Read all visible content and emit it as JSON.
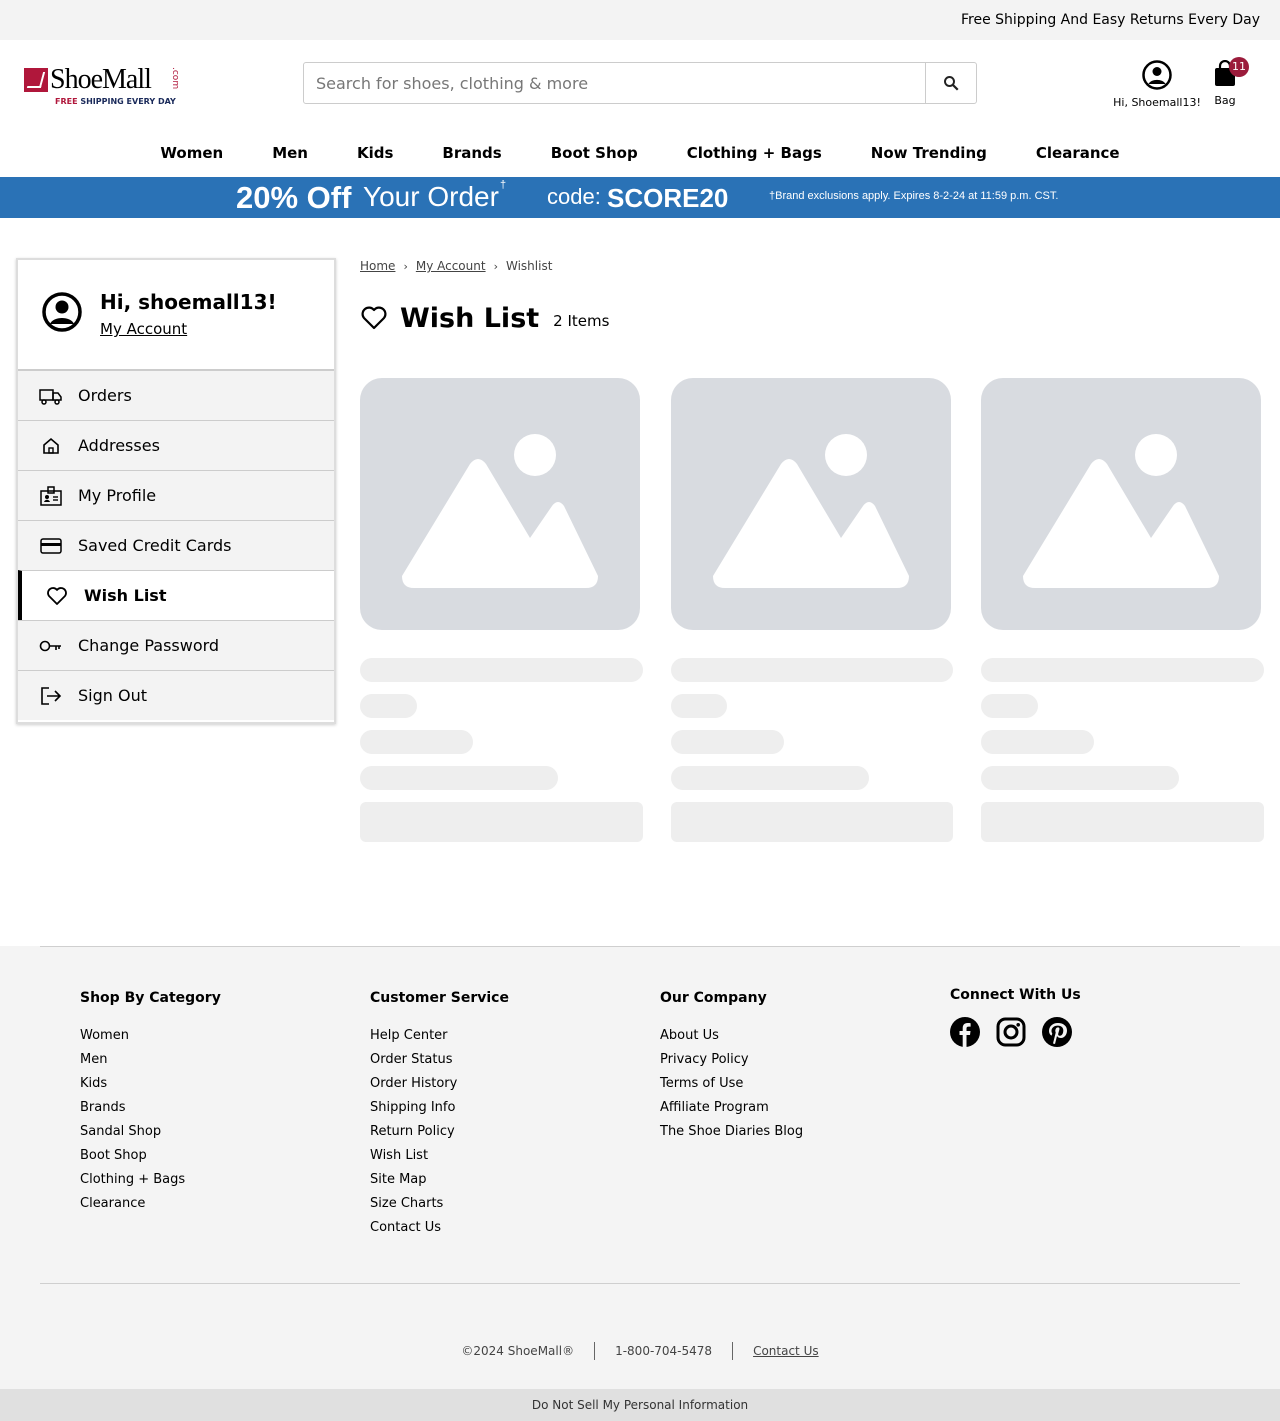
{
  "topbar": {
    "message": "Free Shipping And Easy Returns Every Day"
  },
  "header": {
    "logo_text": "ShoeMall",
    "logo_dotcom": ".com",
    "logo_tag_free": "FREE",
    "logo_tag_rest": " SHIPPING EVERY DAY",
    "search_placeholder": "Search for shoes, clothing & more",
    "account_label": "Hi, Shoemall13!",
    "bag_label": "Bag",
    "bag_count": "11"
  },
  "nav": {
    "items": [
      "Women",
      "Men",
      "Kids",
      "Brands",
      "Boot Shop",
      "Clothing + Bags",
      "Now Trending",
      "Clearance"
    ]
  },
  "promo": {
    "off": "20% Off",
    "your_order": "Your Order",
    "dagger": "†",
    "code_label": "code:",
    "code": "SCORE20",
    "fine_print": "†Brand exclusions apply. Expires 8-2-24 at 11:59 p.m. CST."
  },
  "sidebar": {
    "greeting": "Hi, shoemall13!",
    "my_account": "My Account",
    "items": [
      {
        "label": "Orders",
        "icon": "truck-icon"
      },
      {
        "label": "Addresses",
        "icon": "home-icon"
      },
      {
        "label": "My Profile",
        "icon": "id-badge-icon"
      },
      {
        "label": "Saved Credit Cards",
        "icon": "credit-card-icon"
      },
      {
        "label": "Wish List",
        "icon": "heart-icon",
        "active": true
      },
      {
        "label": "Change Password",
        "icon": "key-icon"
      },
      {
        "label": "Sign Out",
        "icon": "sign-out-icon"
      }
    ]
  },
  "breadcrumb": {
    "home": "Home",
    "account": "My Account",
    "current": "Wishlist"
  },
  "wishlist": {
    "title": "Wish List",
    "count": "2 Items"
  },
  "footer": {
    "col1": {
      "title": "Shop By Category",
      "links": [
        "Women",
        "Men",
        "Kids",
        "Brands",
        "Sandal Shop",
        "Boot Shop",
        "Clothing + Bags",
        "Clearance"
      ]
    },
    "col2": {
      "title": "Customer Service",
      "links": [
        "Help Center",
        "Order Status",
        "Order History",
        "Shipping Info",
        "Return Policy",
        "Wish List",
        "Site Map",
        "Size Charts",
        "Contact Us"
      ]
    },
    "col3": {
      "title": "Our Company",
      "links": [
        "About Us",
        "Privacy Policy",
        "Terms of Use",
        "Affiliate Program",
        "The Shoe Diaries Blog"
      ]
    },
    "col4": {
      "title": "Connect With Us"
    },
    "copyright": "©2024 ShoeMall®",
    "phone": "1-800-704-5478",
    "contact": "Contact Us",
    "do_not_sell": "Do Not Sell My Personal Information"
  }
}
